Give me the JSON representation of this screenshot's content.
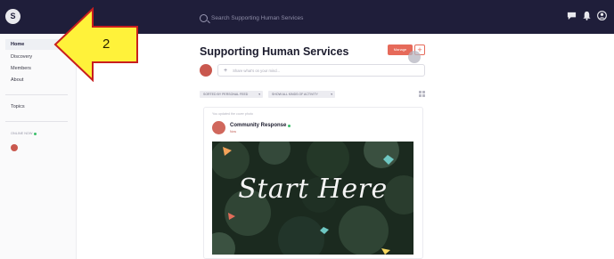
{
  "app": {
    "logo_letter": "S"
  },
  "search": {
    "placeholder": "Search Supporting Human Services"
  },
  "sidebar": {
    "items": [
      {
        "label": "Home"
      },
      {
        "label": "Discovery"
      },
      {
        "label": "Members"
      },
      {
        "label": "About"
      },
      {
        "label": "Topics"
      }
    ],
    "online_label": "ONLINE NOW"
  },
  "annotation": {
    "step_number": "2"
  },
  "main": {
    "title": "Supporting Human Services",
    "manage_label": "Manage",
    "add_label": "+",
    "composer": {
      "plus": "+",
      "placeholder": "Share what's on your mind..."
    },
    "filters": [
      {
        "label": "SORTED BY PERSONAL FEED"
      },
      {
        "label": "SHOW ALL KINDS OF ACTIVITY"
      }
    ],
    "post": {
      "updated_text": "You updated the cover photo",
      "author": "Community Response",
      "time": "Now",
      "image_text": "Start Here"
    }
  },
  "colors": {
    "topbar": "#1f1e3a",
    "accent": "#e66a5a",
    "arrow_fill": "#fff23a",
    "arrow_stroke": "#c81e1e"
  }
}
